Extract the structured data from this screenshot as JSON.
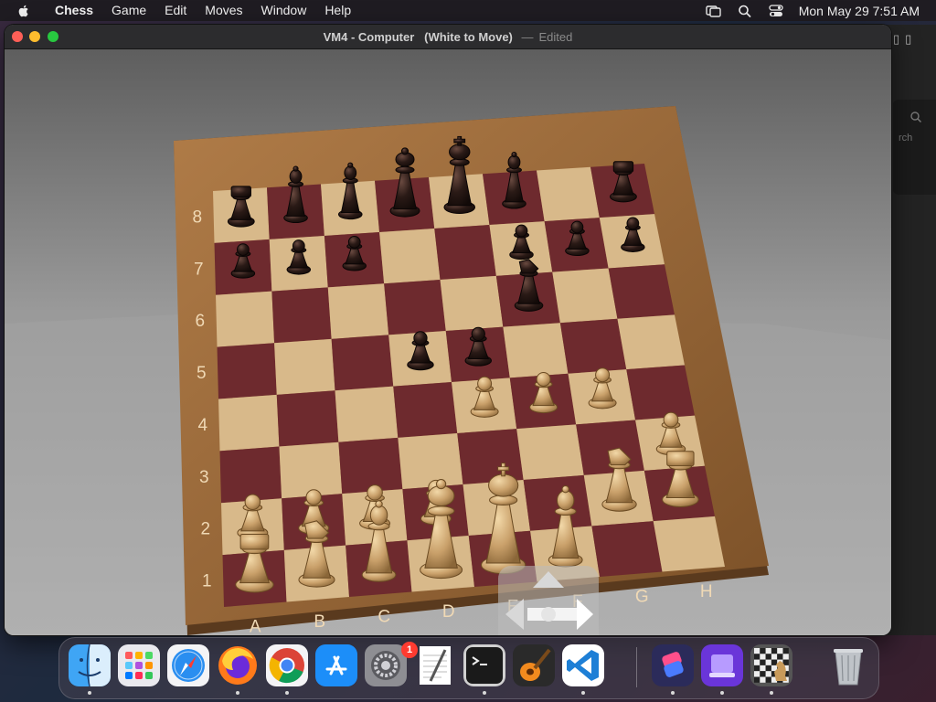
{
  "menubar": {
    "app_name": "Chess",
    "menus": [
      "Game",
      "Edit",
      "Moves",
      "Window",
      "Help"
    ],
    "clock": "Mon May 29  7:51 AM"
  },
  "window": {
    "title": "VM4 - Computer",
    "subtitle": "(White to Move)",
    "separator": "—",
    "status": "Edited"
  },
  "background_window": {
    "search_label": "rch"
  },
  "board": {
    "files": [
      "A",
      "B",
      "C",
      "D",
      "E",
      "F",
      "G",
      "H"
    ],
    "ranks": [
      "1",
      "2",
      "3",
      "4",
      "5",
      "6",
      "7",
      "8"
    ],
    "colors": {
      "dark_square": "#6e2a2e",
      "light_square": "#d8b98a",
      "frame": "#9a6a3c"
    },
    "pieces": [
      {
        "square": "a8",
        "color": "black",
        "type": "rook"
      },
      {
        "square": "b8",
        "color": "black",
        "type": "bishop"
      },
      {
        "square": "c8",
        "color": "black",
        "type": "bishop"
      },
      {
        "square": "d8",
        "color": "black",
        "type": "queen"
      },
      {
        "square": "e8",
        "color": "black",
        "type": "king"
      },
      {
        "square": "f8",
        "color": "black",
        "type": "bishop"
      },
      {
        "square": "h8",
        "color": "black",
        "type": "rook"
      },
      {
        "square": "a7",
        "color": "black",
        "type": "pawn"
      },
      {
        "square": "b7",
        "color": "black",
        "type": "pawn"
      },
      {
        "square": "c7",
        "color": "black",
        "type": "pawn"
      },
      {
        "square": "f7",
        "color": "black",
        "type": "pawn"
      },
      {
        "square": "g7",
        "color": "black",
        "type": "pawn"
      },
      {
        "square": "h7",
        "color": "black",
        "type": "pawn"
      },
      {
        "square": "f6",
        "color": "black",
        "type": "knight"
      },
      {
        "square": "d5",
        "color": "black",
        "type": "pawn"
      },
      {
        "square": "e5",
        "color": "black",
        "type": "pawn"
      },
      {
        "square": "e4",
        "color": "white",
        "type": "pawn"
      },
      {
        "square": "f4",
        "color": "white",
        "type": "pawn"
      },
      {
        "square": "g4",
        "color": "white",
        "type": "pawn"
      },
      {
        "square": "h3",
        "color": "white",
        "type": "pawn"
      },
      {
        "square": "a2",
        "color": "white",
        "type": "pawn"
      },
      {
        "square": "b2",
        "color": "white",
        "type": "pawn"
      },
      {
        "square": "c2",
        "color": "white",
        "type": "pawn"
      },
      {
        "square": "d2",
        "color": "white",
        "type": "pawn"
      },
      {
        "square": "a1",
        "color": "white",
        "type": "rook"
      },
      {
        "square": "b1",
        "color": "white",
        "type": "knight"
      },
      {
        "square": "c1",
        "color": "white",
        "type": "bishop"
      },
      {
        "square": "d1",
        "color": "white",
        "type": "queen"
      },
      {
        "square": "e1",
        "color": "white",
        "type": "king"
      },
      {
        "square": "f1",
        "color": "white",
        "type": "bishop"
      },
      {
        "square": "g2",
        "color": "white",
        "type": "knight"
      },
      {
        "square": "h2",
        "color": "white",
        "type": "rook"
      }
    ]
  },
  "dock": {
    "items": [
      {
        "name": "finder-icon"
      },
      {
        "name": "launchpad-icon"
      },
      {
        "name": "safari-icon"
      },
      {
        "name": "firefox-icon"
      },
      {
        "name": "chrome-icon"
      },
      {
        "name": "app-store-icon"
      },
      {
        "name": "system-settings-icon",
        "badge": "1"
      },
      {
        "name": "textedit-icon"
      },
      {
        "name": "terminal-icon"
      },
      {
        "name": "garageband-icon"
      },
      {
        "name": "vscode-icon"
      },
      {
        "name": "shortcuts-icon"
      },
      {
        "name": "storage-icon"
      },
      {
        "name": "chess-icon"
      },
      {
        "name": "trash-icon"
      }
    ]
  }
}
